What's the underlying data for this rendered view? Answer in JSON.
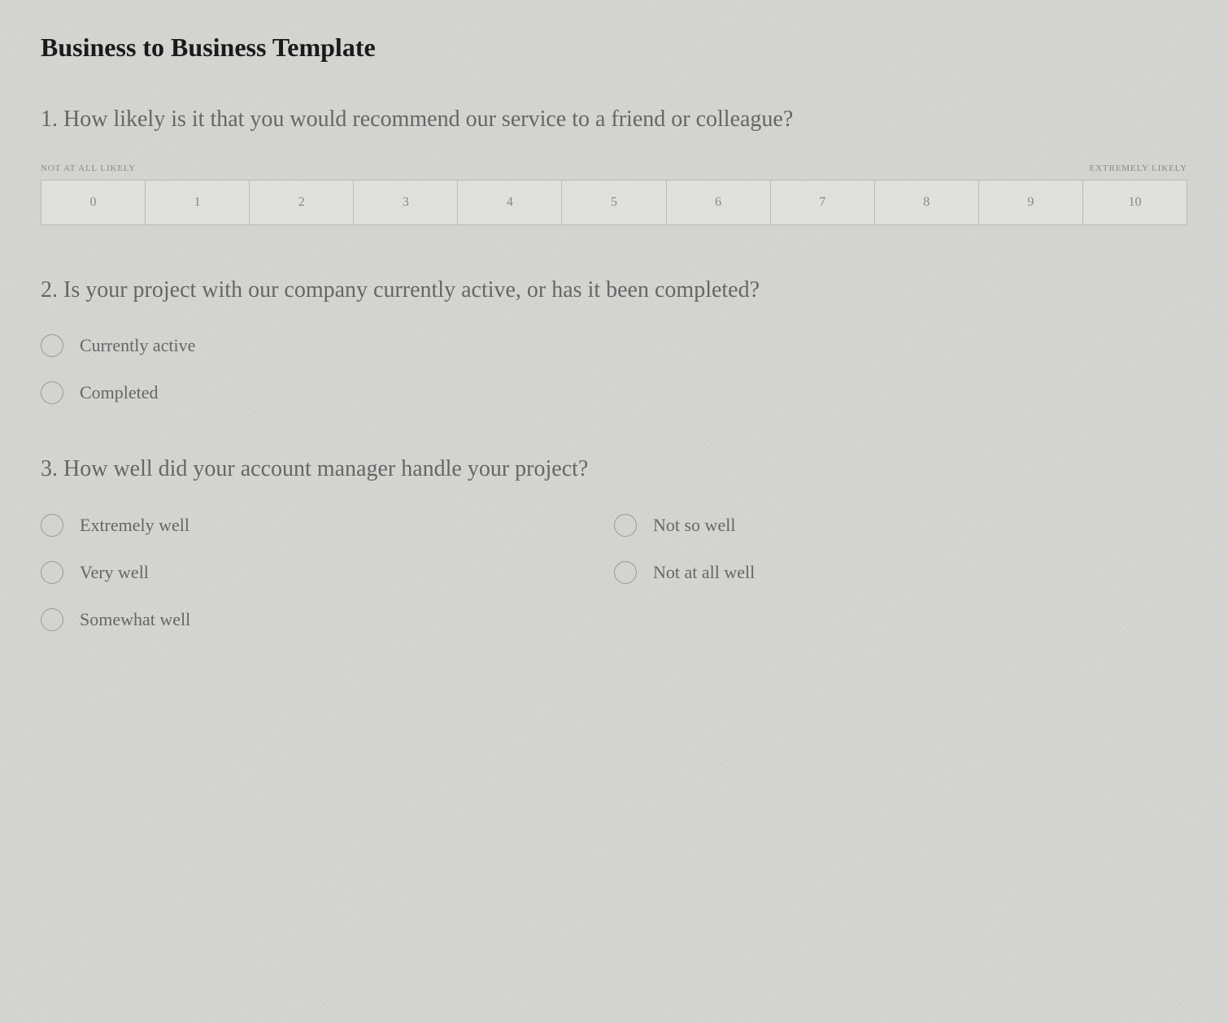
{
  "page": {
    "title": "Business to Business Template"
  },
  "questions": [
    {
      "id": "q1",
      "number": "1.",
      "text": "How likely is it that you would recommend our service to a friend or colleague?",
      "type": "nps",
      "scale": {
        "min_label": "NOT AT ALL LIKELY",
        "max_label": "EXTREMELY LIKELY",
        "values": [
          "0",
          "1",
          "2",
          "3",
          "4",
          "5",
          "6",
          "7",
          "8",
          "9",
          "10"
        ]
      }
    },
    {
      "id": "q2",
      "number": "2.",
      "text": "Is your project with our company currently active, or has it been completed?",
      "type": "radio_vertical",
      "options": [
        {
          "id": "currently_active",
          "label": "Currently active"
        },
        {
          "id": "completed",
          "label": "Completed"
        }
      ]
    },
    {
      "id": "q3",
      "number": "3.",
      "text": "How well did your account manager handle your project?",
      "type": "radio_grid",
      "options_left": [
        {
          "id": "extremely_well",
          "label": "Extremely well"
        },
        {
          "id": "very_well",
          "label": "Very well"
        },
        {
          "id": "somewhat_well",
          "label": "Somewhat well"
        }
      ],
      "options_right": [
        {
          "id": "not_so_well",
          "label": "Not so well"
        },
        {
          "id": "not_at_all_well",
          "label": "Not at all well"
        }
      ]
    }
  ]
}
